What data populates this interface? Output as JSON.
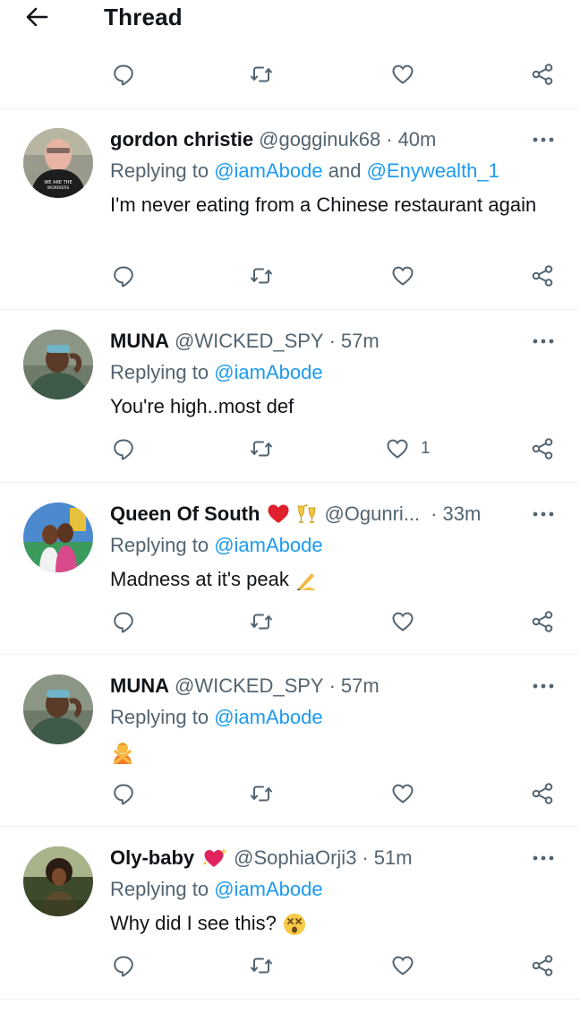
{
  "header": {
    "title": "Thread"
  },
  "top_actions": {
    "reply_count": "",
    "retweet_count": "",
    "like_count": ""
  },
  "tweets": [
    {
      "name": "gordon christie",
      "handle": "@gogginuk68",
      "time": "40m",
      "replying_prefix": "Replying to",
      "mentions": [
        "@iamAbode",
        "@Enywealth_1"
      ],
      "mention_joiner": "and",
      "text": "I'm never eating from a Chinese restaurant again",
      "like_count": ""
    },
    {
      "name": "MUNA",
      "handle": "@WICKED_SPY",
      "time": "57m",
      "replying_prefix": "Replying to",
      "mentions": [
        "@iamAbode"
      ],
      "text": "You're high..most def",
      "like_count": "1"
    },
    {
      "name": "Queen Of South",
      "name_emojis": [
        "red-heart",
        "clinking-glasses"
      ],
      "handle": "@Ogunri...",
      "time": "33m",
      "replying_prefix": "Replying to",
      "mentions": [
        "@iamAbode"
      ],
      "text": "Madness at it's peak",
      "text_emoji": "writing-hand",
      "like_count": ""
    },
    {
      "name": "MUNA",
      "handle": "@WICKED_SPY",
      "time": "57m",
      "replying_prefix": "Replying to",
      "mentions": [
        "@iamAbode"
      ],
      "text": "",
      "text_emoji": "person-gesturing-no",
      "like_count": ""
    },
    {
      "name": "Oly-baby",
      "name_emojis": [
        "sparkling-heart"
      ],
      "handle": "@SophiaOrji3",
      "time": "51m",
      "replying_prefix": "Replying to",
      "mentions": [
        "@iamAbode"
      ],
      "text": "Why did I see this?",
      "text_emoji": "dizzy-face",
      "like_count": ""
    }
  ],
  "colors": {
    "link": "#1d9bf0",
    "secondary": "#536471",
    "divider": "#eff3f4",
    "heart": "#e0245e"
  }
}
